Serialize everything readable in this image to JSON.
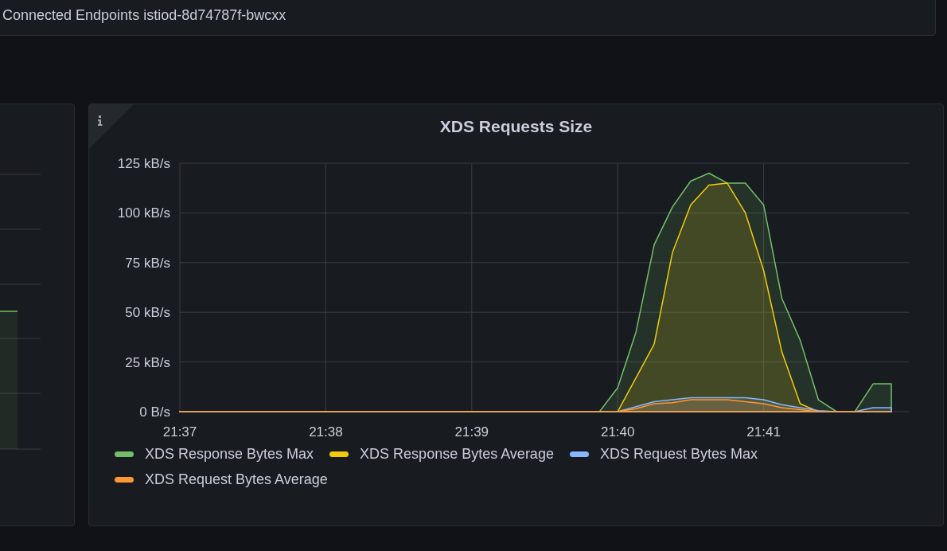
{
  "top_panel": {
    "title": "Connected Endpoints istiod-8d74787f-bwcxx"
  },
  "panel": {
    "title": "XDS Requests Size",
    "chart_data": {
      "type": "area",
      "categories": [
        "21:37",
        null,
        null,
        null,
        null,
        null,
        null,
        null,
        "21:38",
        null,
        null,
        null,
        null,
        null,
        null,
        null,
        "21:39",
        null,
        null,
        null,
        null,
        null,
        null,
        null,
        "21:40",
        null,
        null,
        null,
        null,
        null,
        null,
        null,
        "21:41",
        null,
        null,
        null,
        null,
        null,
        null,
        null
      ],
      "grid": true,
      "ylim": [
        0,
        125
      ],
      "yticks": [
        {
          "value": 0,
          "label": "0 B/s"
        },
        {
          "value": 25,
          "label": "25 kB/s"
        },
        {
          "value": 50,
          "label": "50 kB/s"
        },
        {
          "value": 75,
          "label": "75 kB/s"
        },
        {
          "value": 100,
          "label": "100 kB/s"
        },
        {
          "value": 125,
          "label": "125 kB/s"
        }
      ],
      "series": [
        {
          "name": "XDS Response Bytes Max",
          "color": "#73bf69",
          "values": [
            0,
            0,
            0,
            0,
            0,
            0,
            0,
            0,
            0,
            0,
            0,
            0,
            0,
            0,
            0,
            0,
            0,
            0,
            0,
            0,
            0,
            0,
            0,
            0,
            12,
            40,
            84,
            103,
            116,
            120,
            115,
            115,
            104,
            57,
            36,
            6,
            0,
            0,
            14,
            14
          ]
        },
        {
          "name": "XDS Response Bytes Average",
          "color": "#f2cc0c",
          "values": [
            0,
            0,
            0,
            0,
            0,
            0,
            0,
            0,
            0,
            0,
            0,
            0,
            0,
            0,
            0,
            0,
            0,
            0,
            0,
            0,
            0,
            0,
            0,
            0,
            0,
            17,
            34,
            80,
            104,
            114,
            115,
            100,
            71,
            30,
            4,
            0,
            0,
            0,
            0,
            0
          ]
        },
        {
          "name": "XDS Request Bytes Max",
          "color": "#8ab8ff",
          "values": [
            0,
            0,
            0,
            0,
            0,
            0,
            0,
            0,
            0,
            0,
            0,
            0,
            0,
            0,
            0,
            0,
            0,
            0,
            0,
            0,
            0,
            0,
            0,
            0,
            0,
            2.5,
            5,
            6,
            7,
            7,
            7,
            7,
            6,
            3.5,
            2,
            0.5,
            0,
            0,
            2,
            2
          ]
        },
        {
          "name": "XDS Request Bytes Average",
          "color": "#ff9830",
          "values": [
            0,
            0,
            0,
            0,
            0,
            0,
            0,
            0,
            0,
            0,
            0,
            0,
            0,
            0,
            0,
            0,
            0,
            0,
            0,
            0,
            0,
            0,
            0,
            0,
            0,
            1.5,
            4,
            4.5,
            6,
            6,
            6,
            5,
            4,
            2,
            1,
            0,
            0,
            0,
            0,
            0
          ]
        }
      ]
    }
  }
}
